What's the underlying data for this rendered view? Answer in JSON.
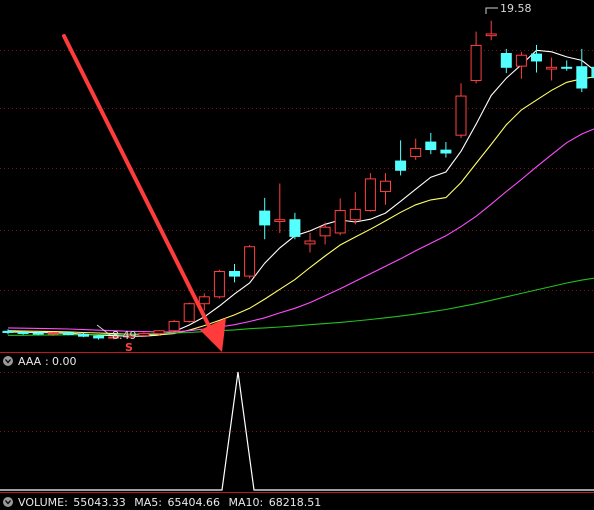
{
  "colors": {
    "background": "#000000",
    "grid": "#7a1414",
    "separator": "#c01818",
    "up": "#ff4040",
    "down": "#54ffff",
    "ma5": "#ffffff",
    "ma10": "#ffff66",
    "ma20": "#ff4dff",
    "ma60": "#22c022",
    "arrow": "#ff3b3b",
    "signal": "#ffffff"
  },
  "icons": {
    "collapse": "chevron-down-icon"
  },
  "chart_data": [
    {
      "type": "candlestick",
      "annotations": {
        "high_label": "19.58",
        "low_label": "8.49",
        "signal_marker": "S"
      },
      "ylim": [
        8.2,
        20.3
      ],
      "grid": true,
      "candles": [
        {
          "o": 8.78,
          "h": 8.85,
          "l": 8.68,
          "c": 8.74
        },
        {
          "o": 8.74,
          "h": 8.8,
          "l": 8.66,
          "c": 8.72
        },
        {
          "o": 8.72,
          "h": 8.79,
          "l": 8.64,
          "c": 8.69
        },
        {
          "o": 8.69,
          "h": 8.76,
          "l": 8.62,
          "c": 8.72
        },
        {
          "o": 8.72,
          "h": 8.78,
          "l": 8.64,
          "c": 8.67
        },
        {
          "o": 8.67,
          "h": 8.74,
          "l": 8.58,
          "c": 8.61
        },
        {
          "o": 8.61,
          "h": 8.66,
          "l": 8.49,
          "c": 8.55
        },
        {
          "o": 8.55,
          "h": 8.62,
          "l": 8.5,
          "c": 8.58
        },
        {
          "o": 8.58,
          "h": 8.66,
          "l": 8.54,
          "c": 8.63
        },
        {
          "o": 8.63,
          "h": 8.74,
          "l": 8.58,
          "c": 8.7
        },
        {
          "o": 8.7,
          "h": 8.82,
          "l": 8.64,
          "c": 8.8
        },
        {
          "o": 8.8,
          "h": 9.18,
          "l": 8.76,
          "c": 9.12
        },
        {
          "o": 9.12,
          "h": 9.78,
          "l": 9.08,
          "c": 9.74
        },
        {
          "o": 9.74,
          "h": 10.1,
          "l": 9.5,
          "c": 9.98
        },
        {
          "o": 9.98,
          "h": 10.92,
          "l": 9.92,
          "c": 10.86
        },
        {
          "o": 10.86,
          "h": 11.12,
          "l": 10.48,
          "c": 10.7
        },
        {
          "o": 10.7,
          "h": 11.78,
          "l": 10.62,
          "c": 11.72
        },
        {
          "o": 12.96,
          "h": 13.42,
          "l": 11.98,
          "c": 12.48
        },
        {
          "o": 12.6,
          "h": 13.92,
          "l": 12.2,
          "c": 12.66
        },
        {
          "o": 12.66,
          "h": 12.9,
          "l": 11.98,
          "c": 12.08
        },
        {
          "o": 11.82,
          "h": 12.2,
          "l": 11.52,
          "c": 11.92
        },
        {
          "o": 12.1,
          "h": 12.56,
          "l": 11.8,
          "c": 12.4
        },
        {
          "o": 12.2,
          "h": 13.4,
          "l": 12.12,
          "c": 12.98
        },
        {
          "o": 12.66,
          "h": 13.62,
          "l": 12.5,
          "c": 13.02
        },
        {
          "o": 12.98,
          "h": 14.28,
          "l": 12.94,
          "c": 14.08
        },
        {
          "o": 13.64,
          "h": 14.28,
          "l": 13.18,
          "c": 14.0
        },
        {
          "o": 14.7,
          "h": 15.42,
          "l": 14.2,
          "c": 14.38
        },
        {
          "o": 14.86,
          "h": 15.48,
          "l": 14.74,
          "c": 15.14
        },
        {
          "o": 15.36,
          "h": 15.68,
          "l": 14.94,
          "c": 15.1
        },
        {
          "o": 15.08,
          "h": 15.36,
          "l": 14.82,
          "c": 14.98
        },
        {
          "o": 15.6,
          "h": 17.4,
          "l": 15.5,
          "c": 16.96
        },
        {
          "o": 17.5,
          "h": 19.2,
          "l": 17.4,
          "c": 18.72
        },
        {
          "o": 19.06,
          "h": 19.58,
          "l": 18.9,
          "c": 19.12
        },
        {
          "o": 18.44,
          "h": 18.6,
          "l": 17.76,
          "c": 17.96
        },
        {
          "o": 18.0,
          "h": 18.5,
          "l": 17.56,
          "c": 18.38
        },
        {
          "o": 18.42,
          "h": 18.74,
          "l": 17.78,
          "c": 18.18
        },
        {
          "o": 17.9,
          "h": 18.3,
          "l": 17.5,
          "c": 17.96
        },
        {
          "o": 17.96,
          "h": 18.2,
          "l": 17.84,
          "c": 17.94
        },
        {
          "o": 17.98,
          "h": 18.6,
          "l": 17.1,
          "c": 17.24
        },
        {
          "o": 17.96,
          "h": 18.1,
          "l": 16.8,
          "c": 17.6
        }
      ],
      "moving_averages": [
        {
          "name": "MA5",
          "values": [
            8.76,
            8.75,
            8.74,
            8.73,
            8.71,
            8.68,
            8.65,
            8.63,
            8.61,
            8.61,
            8.65,
            8.77,
            9.0,
            9.28,
            9.66,
            10.08,
            10.46,
            11.15,
            11.68,
            12.1,
            12.27,
            12.5,
            12.65,
            12.58,
            12.68,
            12.89,
            13.3,
            13.72,
            14.14,
            14.32,
            15.04,
            15.98,
            16.98,
            17.58,
            18.05,
            18.55,
            18.5,
            18.32,
            18.2,
            17.79
          ]
        },
        {
          "name": "MA10",
          "values": [
            8.8,
            8.79,
            8.78,
            8.77,
            8.76,
            8.74,
            8.72,
            8.7,
            8.68,
            8.67,
            8.66,
            8.7,
            8.82,
            8.98,
            9.16,
            9.35,
            9.58,
            9.9,
            10.24,
            10.58,
            11.0,
            11.4,
            11.78,
            12.06,
            12.33,
            12.62,
            12.92,
            13.18,
            13.35,
            13.43,
            13.95,
            14.62,
            15.28,
            15.96,
            16.48,
            16.82,
            17.16,
            17.44,
            17.56,
            17.64
          ]
        },
        {
          "name": "MA20",
          "values": [
            8.9,
            8.89,
            8.88,
            8.87,
            8.86,
            8.84,
            8.82,
            8.8,
            8.78,
            8.77,
            8.76,
            8.76,
            8.8,
            8.86,
            8.93,
            9.01,
            9.12,
            9.25,
            9.42,
            9.58,
            9.78,
            10.02,
            10.26,
            10.52,
            10.78,
            11.04,
            11.3,
            11.58,
            11.84,
            12.1,
            12.42,
            12.78,
            13.2,
            13.64,
            14.06,
            14.5,
            14.92,
            15.34,
            15.64,
            15.86
          ]
        },
        {
          "name": "MA60",
          "values": [
            8.64,
            8.64,
            8.65,
            8.65,
            8.66,
            8.66,
            8.67,
            8.67,
            8.68,
            8.69,
            8.7,
            8.72,
            8.74,
            8.77,
            8.8,
            8.83,
            8.87,
            8.9,
            8.93,
            8.97,
            9.01,
            9.05,
            9.09,
            9.14,
            9.19,
            9.25,
            9.31,
            9.38,
            9.46,
            9.54,
            9.64,
            9.74,
            9.86,
            9.98,
            10.1,
            10.22,
            10.34,
            10.46,
            10.56,
            10.64
          ]
        }
      ]
    },
    {
      "type": "line",
      "title": "AAA",
      "current_value": "0.00",
      "ylim": [
        0,
        1
      ],
      "values": [
        0,
        0,
        0,
        0,
        0,
        0,
        0,
        0,
        0,
        0,
        0,
        0,
        0,
        0,
        0,
        0,
        1,
        0,
        0,
        0,
        0,
        0,
        0,
        0,
        0,
        0,
        0,
        0,
        0,
        0,
        0,
        0,
        0,
        0,
        0,
        0,
        0,
        0,
        0,
        0
      ]
    }
  ],
  "volume_bar": {
    "volume_label": "VOLUME:",
    "volume_value": "55043.33",
    "ma5_label": "MA5:",
    "ma5_value": "65404.66",
    "ma10_label": "MA10:",
    "ma10_value": "68218.51"
  }
}
